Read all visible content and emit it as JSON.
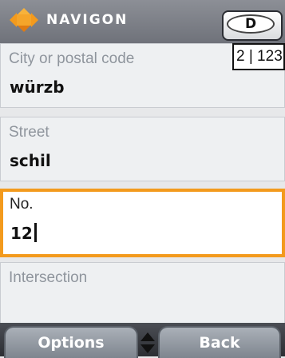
{
  "header": {
    "brand": "NAVIGON",
    "country_code": "D"
  },
  "fields": {
    "city": {
      "label": "City or postal code",
      "value": "würzb"
    },
    "street": {
      "label": "Street",
      "value": "schil"
    },
    "number": {
      "label": "No.",
      "value": "12"
    },
    "intersection": {
      "label": "Intersection",
      "value": ""
    }
  },
  "house_range": "2 | 123",
  "footer": {
    "options_label": "Options",
    "back_label": "Back"
  },
  "colors": {
    "accent_orange": "#f39a1d",
    "header_gray": "#7c8088",
    "field_bg": "#eef0f2"
  },
  "icons": [
    "navigon-logo-icon",
    "up-down-arrows-icon"
  ]
}
